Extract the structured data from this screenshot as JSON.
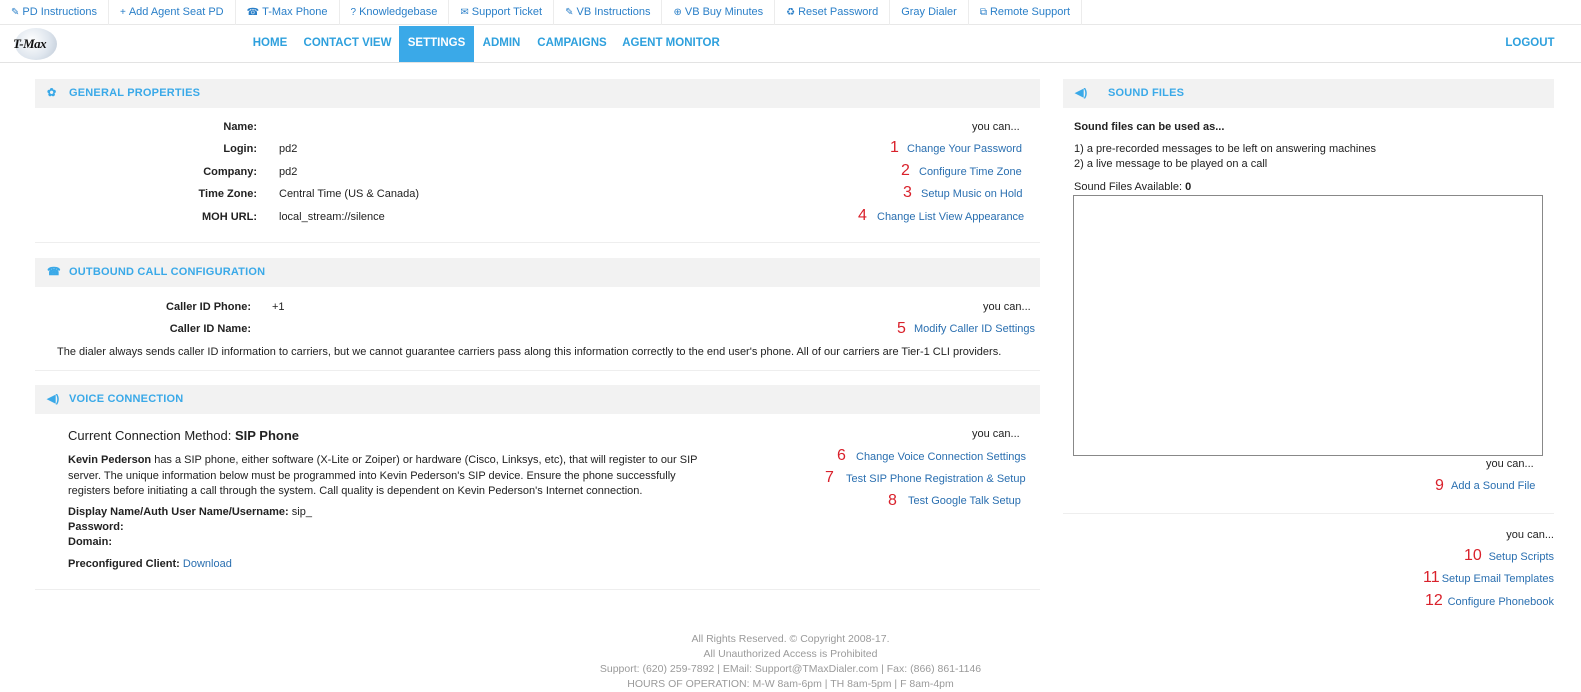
{
  "toplinks": [
    {
      "icon": "✎",
      "label": "PD Instructions",
      "name": "pd-instructions"
    },
    {
      "icon": "+",
      "label": "Add Agent Seat PD",
      "name": "add-agent-seat"
    },
    {
      "icon": "☎",
      "label": "T-Max Phone",
      "name": "tmax-phone"
    },
    {
      "icon": "?",
      "label": "Knowledgebase",
      "name": "knowledgebase"
    },
    {
      "icon": "✉",
      "label": "Support Ticket",
      "name": "support-ticket"
    },
    {
      "icon": "✎",
      "label": "VB Instructions",
      "name": "vb-instructions"
    },
    {
      "icon": "⊕",
      "label": "VB Buy Minutes",
      "name": "vb-buy-minutes"
    },
    {
      "icon": "♻",
      "label": "Reset Password",
      "name": "reset-password"
    },
    {
      "icon": "",
      "label": "Gray Dialer",
      "name": "gray-dialer"
    },
    {
      "icon": "⧉",
      "label": "Remote Support",
      "name": "remote-support"
    }
  ],
  "logo": {
    "text": "T-Max"
  },
  "nav": {
    "home": "HOME",
    "contact_view": "CONTACT VIEW",
    "settings": "SETTINGS",
    "admin": "ADMIN",
    "campaigns": "CAMPAIGNS",
    "agent_monitor": "AGENT MONITOR",
    "logout": "LOGOUT"
  },
  "general": {
    "title": "GENERAL PROPERTIES",
    "name_label": "Name:",
    "name_value": "",
    "login_label": "Login:",
    "login_value": "pd2",
    "company_label": "Company:",
    "company_value": "pd2",
    "tz_label": "Time Zone:",
    "tz_value": "Central Time (US & Canada)",
    "moh_label": "MOH URL:",
    "moh_value": "local_stream://silence",
    "youcan": "you can...",
    "links": [
      {
        "n": "1",
        "label": "Change Your Password"
      },
      {
        "n": "2",
        "label": "Configure Time Zone"
      },
      {
        "n": "3",
        "label": "Setup Music on Hold"
      },
      {
        "n": "4",
        "label": "Change List View Appearance"
      }
    ]
  },
  "outbound": {
    "title": "OUTBOUND CALL CONFIGURATION",
    "cid_phone_label": "Caller ID Phone:",
    "cid_phone_value": "+1",
    "cid_name_label": "Caller ID Name:",
    "cid_name_value": "",
    "youcan": "you can...",
    "link_n": "5",
    "link": "Modify Caller ID Settings",
    "note": "The dialer always sends caller ID information to carriers, but we cannot guarantee carriers pass along this information correctly to the end user's phone. All of our carriers are Tier-1 CLI providers."
  },
  "voice": {
    "title": "VOICE CONNECTION",
    "method_label": "Current Connection Method: ",
    "method_value": "SIP Phone",
    "desc_name": "Kevin Pederson",
    "desc_line1": " has a SIP phone, either software (X-Lite or Zoiper) or hardware (Cisco, Linksys, etc), that will register to our SIP",
    "desc_line2": "server. The unique information below must be programmed into Kevin Pederson's SIP device. Ensure the phone successfully",
    "desc_line3": "registers before initiating a call through the system. Call quality is dependent on Kevin Pederson's Internet connection.",
    "auth_label": "Display Name/Auth User Name/Username:",
    "auth_value": " sip_",
    "password_label": "Password:",
    "domain_label": "Domain:",
    "client_label": "Preconfigured Client:",
    "client_link": "Download",
    "youcan": "you can...",
    "links": [
      {
        "n": "6",
        "label": "Change Voice Connection Settings"
      },
      {
        "n": "7",
        "label": "Test SIP Phone Registration & Setup"
      },
      {
        "n": "8",
        "label": "Test Google Talk Setup"
      }
    ]
  },
  "sound": {
    "title": "SOUND FILES",
    "intro": "Sound files can be used as...",
    "use1": "1) a pre-recorded messages to be left on answering machines",
    "use2": "2) a live message to be played on a call",
    "available_label": "Sound Files Available: ",
    "available_count": "0",
    "youcan": "you can...",
    "link_n": "9",
    "link": "Add a Sound File"
  },
  "extra": {
    "youcan": "you can...",
    "links": [
      {
        "n": "10",
        "label": "Setup Scripts"
      },
      {
        "n": "11",
        "label": "Setup Email Templates"
      },
      {
        "n": "12",
        "label": "Configure Phonebook"
      }
    ]
  },
  "footer": {
    "line1": "All Rights Reserved. © Copyright 2008-17.",
    "line2": "All Unauthorized Access is Prohibited",
    "line3": "Support: (620) 259-7892 | EMail: Support@TMaxDialer.com | Fax: (866) 861-1146",
    "line4": "HOURS OF OPERATION: M-W 8am-6pm | TH 8am-5pm | F 8am-4pm"
  },
  "colors": {
    "accent": "#3aa9e8",
    "link": "#2a6fb0",
    "number": "#d9212b",
    "header_bg": "#f2f2f2"
  }
}
